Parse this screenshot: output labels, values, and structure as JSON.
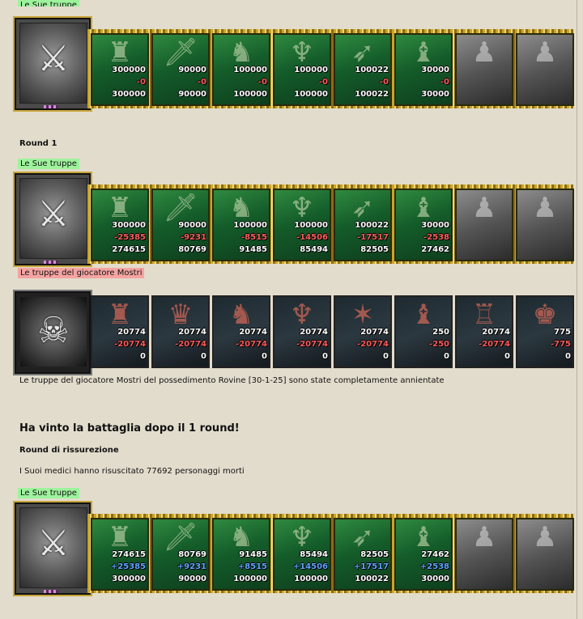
{
  "top_badge": "Le Sue truppe",
  "sections": {
    "round1_title": "Round 1",
    "your_troops_label": "Le Sue truppe",
    "monster_troops_label": "Le truppe del giocatore Mostri",
    "annihilated_text": "Le truppe del giocatore Mostri del possedimento Rovine [30-1-25] sono state completamente annientate",
    "victory_heading": "Ha vinto la battaglia dopo il 1 round!",
    "resurrection_title": "Round di rissurezione",
    "resurrection_text": "I Suoi medici hanno risuscitato 77692 personaggi morti",
    "your_troops_label_2": "Le Sue truppe"
  },
  "army_initial": {
    "units": [
      {
        "icon": "troll-warrior-icon",
        "a": "300000",
        "b": "-0",
        "c": "300000"
      },
      {
        "icon": "elf-swordsman-icon",
        "a": "90000",
        "b": "-0",
        "c": "90000"
      },
      {
        "icon": "elf-lancer-icon",
        "a": "100000",
        "b": "-0",
        "c": "100000"
      },
      {
        "icon": "winged-beast-icon",
        "a": "100000",
        "b": "-0",
        "c": "100000"
      },
      {
        "icon": "elf-archer-icon",
        "a": "100022",
        "b": "-0",
        "c": "100022"
      },
      {
        "icon": "druid-icon",
        "a": "30000",
        "b": "-0",
        "c": "30000"
      },
      {
        "icon": "locked-unit-icon",
        "a": "",
        "b": "",
        "c": ""
      },
      {
        "icon": "locked-unit-icon",
        "a": "",
        "b": "",
        "c": ""
      }
    ]
  },
  "army_round1": {
    "units": [
      {
        "icon": "troll-warrior-icon",
        "a": "300000",
        "b": "-25385",
        "c": "274615"
      },
      {
        "icon": "elf-swordsman-icon",
        "a": "90000",
        "b": "-9231",
        "c": "80769"
      },
      {
        "icon": "elf-lancer-icon",
        "a": "100000",
        "b": "-8515",
        "c": "91485"
      },
      {
        "icon": "winged-beast-icon",
        "a": "100000",
        "b": "-14506",
        "c": "85494"
      },
      {
        "icon": "elf-archer-icon",
        "a": "100022",
        "b": "-17517",
        "c": "82505"
      },
      {
        "icon": "druid-icon",
        "a": "30000",
        "b": "-2538",
        "c": "27462"
      },
      {
        "icon": "locked-unit-icon",
        "a": "",
        "b": "",
        "c": ""
      },
      {
        "icon": "locked-unit-icon",
        "a": "",
        "b": "",
        "c": ""
      }
    ]
  },
  "monster_army": {
    "units": [
      {
        "icon": "lizard-warrior-icon",
        "a": "20774",
        "b": "-20774",
        "c": "0"
      },
      {
        "icon": "armored-beast-icon",
        "a": "20774",
        "b": "-20774",
        "c": "0"
      },
      {
        "icon": "orc-shield-icon",
        "a": "20774",
        "b": "-20774",
        "c": "0"
      },
      {
        "icon": "red-demon-icon",
        "a": "20774",
        "b": "-20774",
        "c": "0"
      },
      {
        "icon": "spider-icon",
        "a": "20774",
        "b": "-20774",
        "c": "0"
      },
      {
        "icon": "red-wraith-icon",
        "a": "250",
        "b": "-250",
        "c": "0"
      },
      {
        "icon": "spiked-golem-icon",
        "a": "20774",
        "b": "-20774",
        "c": "0"
      },
      {
        "icon": "dark-mage-icon",
        "a": "775",
        "b": "-775",
        "c": "0"
      }
    ]
  },
  "army_resurrected": {
    "units": [
      {
        "icon": "troll-warrior-icon",
        "a": "274615",
        "b": "+25385",
        "c": "300000"
      },
      {
        "icon": "elf-swordsman-icon",
        "a": "80769",
        "b": "+9231",
        "c": "90000"
      },
      {
        "icon": "elf-lancer-icon",
        "a": "91485",
        "b": "+8515",
        "c": "100000"
      },
      {
        "icon": "winged-beast-icon",
        "a": "85494",
        "b": "+14506",
        "c": "100000"
      },
      {
        "icon": "elf-archer-icon",
        "a": "82505",
        "b": "+17517",
        "c": "100022"
      },
      {
        "icon": "druid-icon",
        "a": "27462",
        "b": "+2538",
        "c": "30000"
      },
      {
        "icon": "locked-unit-icon",
        "a": "",
        "b": "",
        "c": ""
      },
      {
        "icon": "locked-unit-icon",
        "a": "",
        "b": "",
        "c": ""
      }
    ]
  },
  "emblems": {
    "player": "crest-bow-arrows-icon",
    "monster": "monster-mask-icon"
  }
}
